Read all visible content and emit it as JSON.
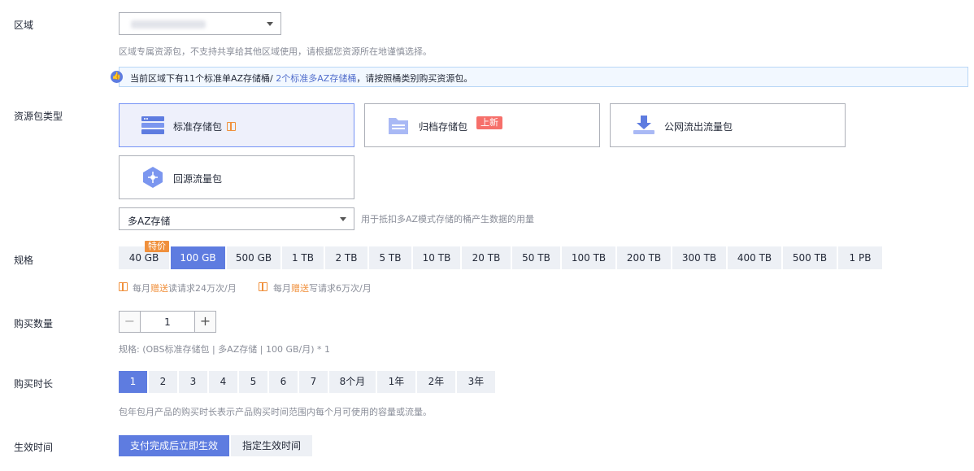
{
  "region": {
    "label": "区域",
    "hint": "区域专属资源包，不支持共享给其他区域使用，请根据您资源所在地谨慎选择。",
    "info_prefix": "当前区域下有11个标准单AZ存储桶/ ",
    "info_highlight": "2个标准多AZ存储桶",
    "info_suffix": "，请按照桶类别购买资源包。"
  },
  "package_type": {
    "label": "资源包类型",
    "cards": [
      {
        "label": "标准存储包",
        "icon": "storage-icon"
      },
      {
        "label": "归档存储包",
        "icon": "archive-icon",
        "badge": "上新"
      },
      {
        "label": "公网流出流量包",
        "icon": "download-icon"
      },
      {
        "label": "回源流量包",
        "icon": "hexagon-icon"
      }
    ],
    "storage_select_value": "多AZ存储",
    "storage_hint": "用于抵扣多AZ模式存储的桶产生数据的用量"
  },
  "spec": {
    "label": "规格",
    "special_tag": "特价",
    "options": [
      "40 GB",
      "100 GB",
      "500 GB",
      "1 TB",
      "2 TB",
      "5 TB",
      "10 TB",
      "20 TB",
      "50 TB",
      "100 TB",
      "200 TB",
      "300 TB",
      "400 TB",
      "500 TB",
      "1 PB"
    ],
    "selected": "100 GB",
    "gift1_pre": "每月",
    "gift1_orange": "赠送",
    "gift1_post": "读请求24万次/月",
    "gift2_pre": "每月",
    "gift2_orange": "赠送",
    "gift2_post": "写请求6万次/月"
  },
  "quantity": {
    "label": "购买数量",
    "value": "1",
    "summary": "规格: (OBS标准存储包 | 多AZ存储 | 100 GB/月) * 1"
  },
  "duration": {
    "label": "购买时长",
    "options": [
      "1",
      "2",
      "3",
      "4",
      "5",
      "6",
      "7",
      "8个月",
      "1年",
      "2年",
      "3年"
    ],
    "selected": "1",
    "hint": "包年包月产品的购买时长表示产品购买时间范围内每个月可使用的容量或流量。"
  },
  "effective": {
    "label": "生效时间",
    "options": [
      "支付完成后立即生效",
      "指定生效时间"
    ],
    "selected": "支付完成后立即生效"
  },
  "colors": {
    "primary": "#5e7ce0",
    "button_bg": "#edf0f5",
    "orange": "#f0903c",
    "new_badge": "#f66f6a"
  }
}
